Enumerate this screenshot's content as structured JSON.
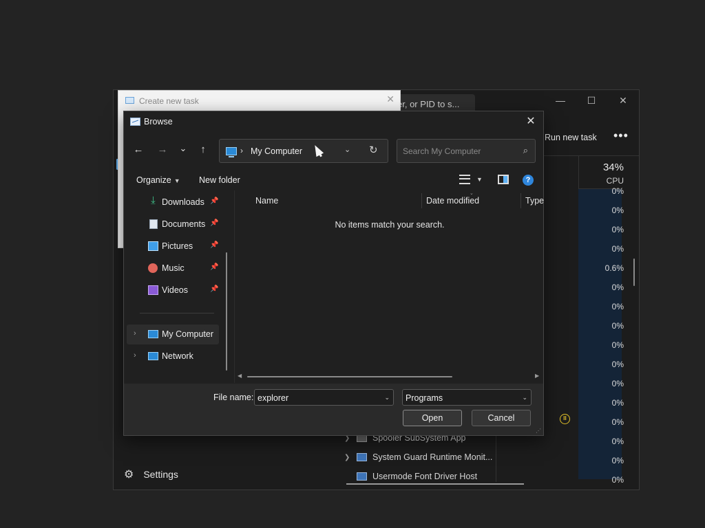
{
  "task_manager": {
    "search_text": "er, or PID to s...",
    "window_buttons": [
      "—",
      "☐",
      "✕"
    ],
    "run_new_task": "Run new task",
    "more": "•••",
    "cpu_total": "34%",
    "cpu_label": "CPU",
    "cpu_values": [
      "0%",
      "0%",
      "0%",
      "0%",
      "0.6%",
      "0%",
      "0%",
      "0%",
      "0%",
      "0%",
      "0%",
      "0%",
      "0%",
      "0%",
      "0%",
      "0%"
    ],
    "processes": [
      "Spooler SubSystem App",
      "System Guard Runtime Monit...",
      "Usermode Font Driver Host"
    ],
    "settings": "Settings"
  },
  "create_new_task": {
    "title": "Create new task",
    "close": "✕"
  },
  "browse": {
    "title": "Browse",
    "close": "✕",
    "nav": {
      "back": "←",
      "forward": "→",
      "recent": "⌄",
      "up": "↑"
    },
    "address": {
      "separator": "›",
      "location": "My Computer",
      "dropdown": "⌄",
      "refresh": "↻"
    },
    "search": {
      "placeholder": "Search My Computer",
      "icon": "⌕"
    },
    "commands": {
      "organize": "Organize",
      "new_folder": "New folder",
      "help": "?"
    },
    "nav_pane": {
      "items": [
        {
          "label": "Downloads",
          "icon": "download-icon",
          "pinned": true
        },
        {
          "label": "Documents",
          "icon": "documents-icon",
          "pinned": true
        },
        {
          "label": "Pictures",
          "icon": "pictures-icon",
          "pinned": true
        },
        {
          "label": "Music",
          "icon": "music-icon",
          "pinned": true
        },
        {
          "label": "Videos",
          "icon": "videos-icon",
          "pinned": true
        },
        {
          "label": "My Computer",
          "icon": "computer-icon",
          "selected": true
        },
        {
          "label": "Network",
          "icon": "network-icon"
        }
      ]
    },
    "file_list": {
      "columns": [
        "Name",
        "Date modified",
        "Type"
      ],
      "empty_message": "No items match your search."
    },
    "footer": {
      "file_name_label": "File name:",
      "file_name_value": "explorer",
      "file_type": "Programs",
      "open": "Open",
      "cancel": "Cancel"
    }
  },
  "colors": {
    "accent": "#5fb2f5",
    "dialog_bg": "#202020",
    "footer_bg": "#2a2a2a",
    "cpu_column": "#142437"
  }
}
